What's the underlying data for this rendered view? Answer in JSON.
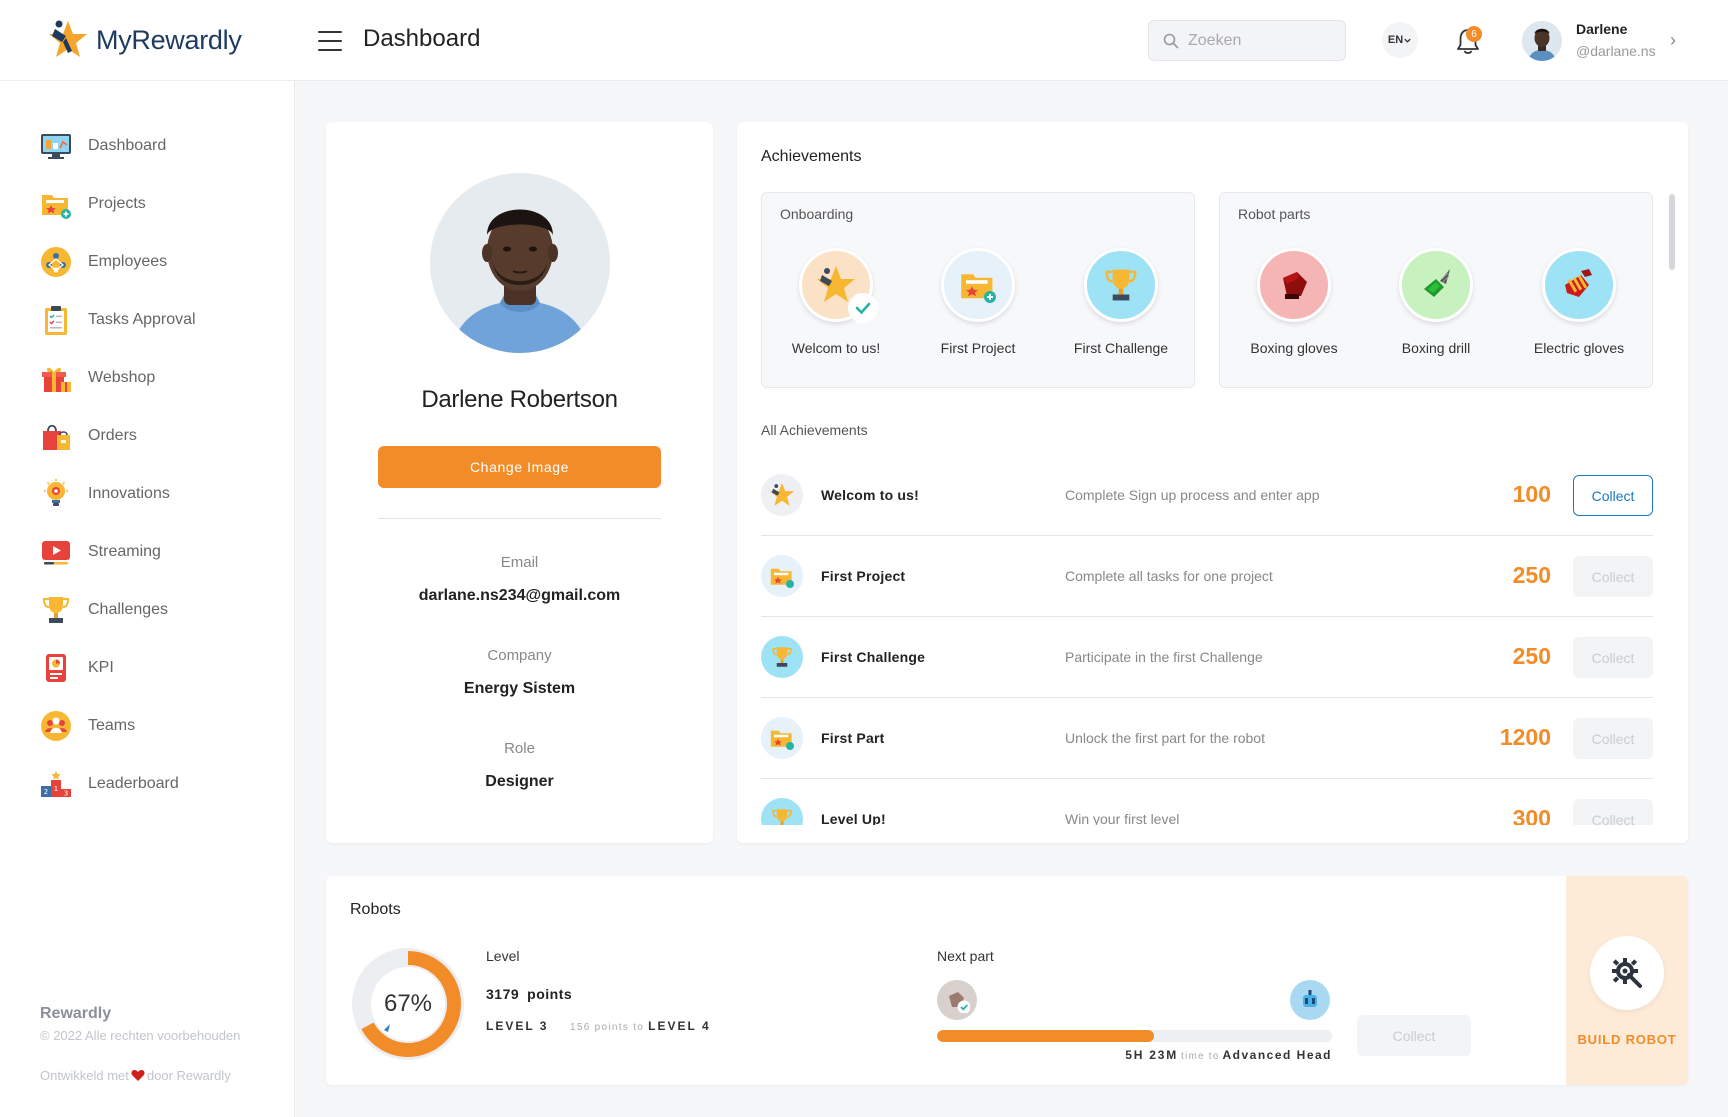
{
  "app": {
    "name": "MyRewardly"
  },
  "header": {
    "page_title": "Dashboard",
    "search_placeholder": "Zoeken",
    "language": "EN",
    "notification_count": "6",
    "user": {
      "name": "Darlene",
      "handle": "@darlane.ns"
    }
  },
  "sidebar": {
    "items": [
      {
        "label": "Dashboard",
        "icon": "monitor-icon"
      },
      {
        "label": "Projects",
        "icon": "folder-star-icon"
      },
      {
        "label": "Employees",
        "icon": "people-network-icon"
      },
      {
        "label": "Tasks Approval",
        "icon": "clipboard-icon"
      },
      {
        "label": "Webshop",
        "icon": "gift-icon"
      },
      {
        "label": "Orders",
        "icon": "shopping-bag-icon"
      },
      {
        "label": "Innovations",
        "icon": "lightbulb-icon"
      },
      {
        "label": "Streaming",
        "icon": "video-play-icon"
      },
      {
        "label": "Challenges",
        "icon": "trophy-icon"
      },
      {
        "label": "KPI",
        "icon": "report-icon"
      },
      {
        "label": "Teams",
        "icon": "team-icon"
      },
      {
        "label": "Leaderboard",
        "icon": "podium-icon"
      }
    ],
    "footer": {
      "brand": "Rewardly",
      "copyright": "© 2022 Alle rechten voorbehouden",
      "developed_prefix": "Ontwikkeld met",
      "developed_suffix": "door Rewardly"
    }
  },
  "profile": {
    "name": "Darlene Robertson",
    "change_image_label": "Change Image",
    "email_label": "Email",
    "email": "darlane.ns234@gmail.com",
    "company_label": "Company",
    "company": "Energy Sistem",
    "role_label": "Role",
    "role": "Designer"
  },
  "achievements": {
    "title": "Achievements",
    "groups": [
      {
        "title": "Onboarding",
        "badges": [
          {
            "label": "Welcom to us!",
            "icon": "star-icon",
            "completed": true
          },
          {
            "label": "First Project",
            "icon": "folder-star-icon",
            "completed": false
          },
          {
            "label": "First Challenge",
            "icon": "trophy-icon",
            "completed": false
          }
        ]
      },
      {
        "title": "Robot parts",
        "badges": [
          {
            "label": "Boxing gloves",
            "icon": "boxing-gloves-icon"
          },
          {
            "label": "Boxing drill",
            "icon": "drill-icon"
          },
          {
            "label": "Electric gloves",
            "icon": "electric-gloves-icon"
          }
        ]
      }
    ],
    "all_title": "All Achievements",
    "list": [
      {
        "name": "Welcom to us!",
        "description": "Complete Sign up process and enter app",
        "points": "100",
        "collect_label": "Collect",
        "collectable": true,
        "icon": "star-icon"
      },
      {
        "name": "First Project",
        "description": "Complete all tasks for one project",
        "points": "250",
        "collect_label": "Collect",
        "collectable": false,
        "icon": "folder-star-icon"
      },
      {
        "name": "First Challenge",
        "description": "Participate in the first Challenge",
        "points": "250",
        "collect_label": "Collect",
        "collectable": false,
        "icon": "trophy-icon"
      },
      {
        "name": "First Part",
        "description": "Unlock the first part for the robot",
        "points": "1200",
        "collect_label": "Collect",
        "collectable": false,
        "icon": "folder-star-icon"
      },
      {
        "name": "Level Up!",
        "description": "Win your first level",
        "points": "300",
        "collect_label": "Collect",
        "collectable": false,
        "icon": "trophy-icon"
      }
    ]
  },
  "robots": {
    "title": "Robots",
    "level_progress": 0.67,
    "level_percent_text": "67%",
    "level_label": "Level",
    "points_value": "3179",
    "points_unit": "points",
    "current_level": "LEVEL 3",
    "points_to_next": "156 points to",
    "next_level": "LEVEL 4",
    "next_part_label": "Next part",
    "next_part_progress": 0.55,
    "time_remaining": "5H 23M",
    "time_to_label": "time to",
    "next_part_name": "Advanced Head",
    "collect_label": "Collect",
    "build_label": "BUILD ROBOT"
  },
  "colors": {
    "accent": "#f28c28",
    "link": "#1a78c2",
    "build_panel": "#fdebd7"
  }
}
